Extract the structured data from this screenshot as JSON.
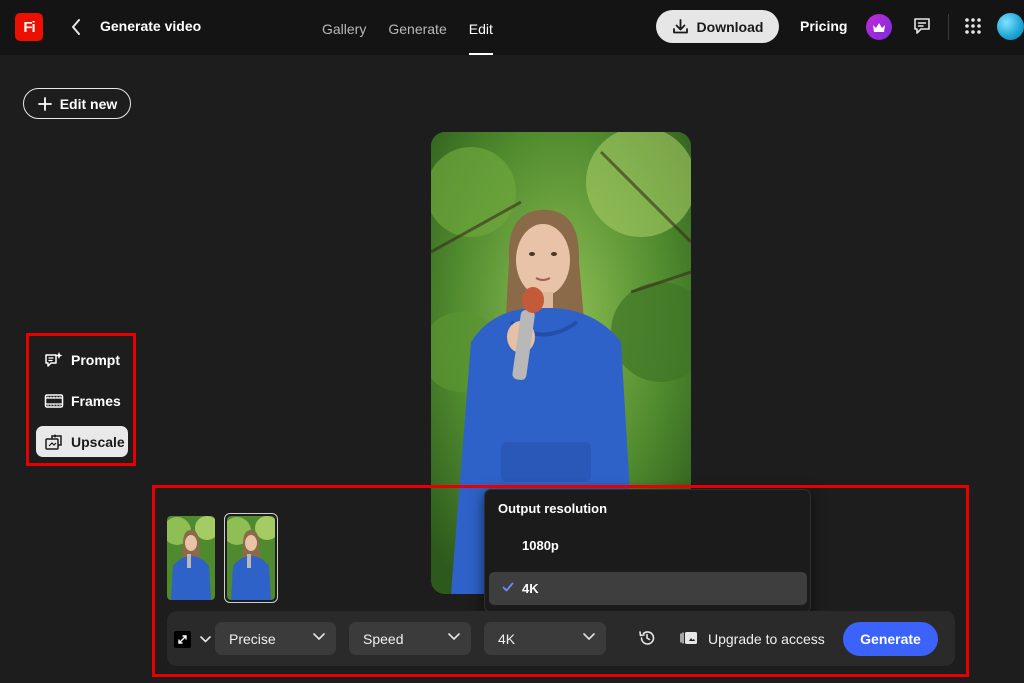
{
  "app": {
    "logo_text": "Fi",
    "page_title": "Generate video",
    "brand_color": "#eb1000"
  },
  "nav": {
    "tabs": [
      {
        "label": "Gallery",
        "active": false
      },
      {
        "label": "Generate",
        "active": false
      },
      {
        "label": "Edit",
        "active": true
      }
    ]
  },
  "header": {
    "download_label": "Download",
    "pricing_label": "Pricing",
    "icons": [
      "chevron-left-icon",
      "download-icon",
      "crown-icon",
      "chat-icon",
      "apps-grid-icon",
      "avatar"
    ]
  },
  "sidebar": {
    "edit_new_label": "Edit new",
    "modes": [
      {
        "label": "Prompt",
        "icon": "prompt-sparkle-icon",
        "selected": false
      },
      {
        "label": "Frames",
        "icon": "film-frames-icon",
        "selected": false
      },
      {
        "label": "Upscale",
        "icon": "upscale-icon",
        "selected": true
      }
    ]
  },
  "resolution_menu": {
    "title": "Output resolution",
    "options": [
      {
        "label": "1080p",
        "selected": false
      },
      {
        "label": "4K",
        "selected": true
      }
    ]
  },
  "toolbar": {
    "mode_select": "Precise",
    "speed_select": "Speed",
    "resolution_select": "4K",
    "upgrade_label": "Upgrade to access",
    "generate_label": "Generate",
    "accent_color": "#3b63fb"
  },
  "annotation_color": "#e60000"
}
